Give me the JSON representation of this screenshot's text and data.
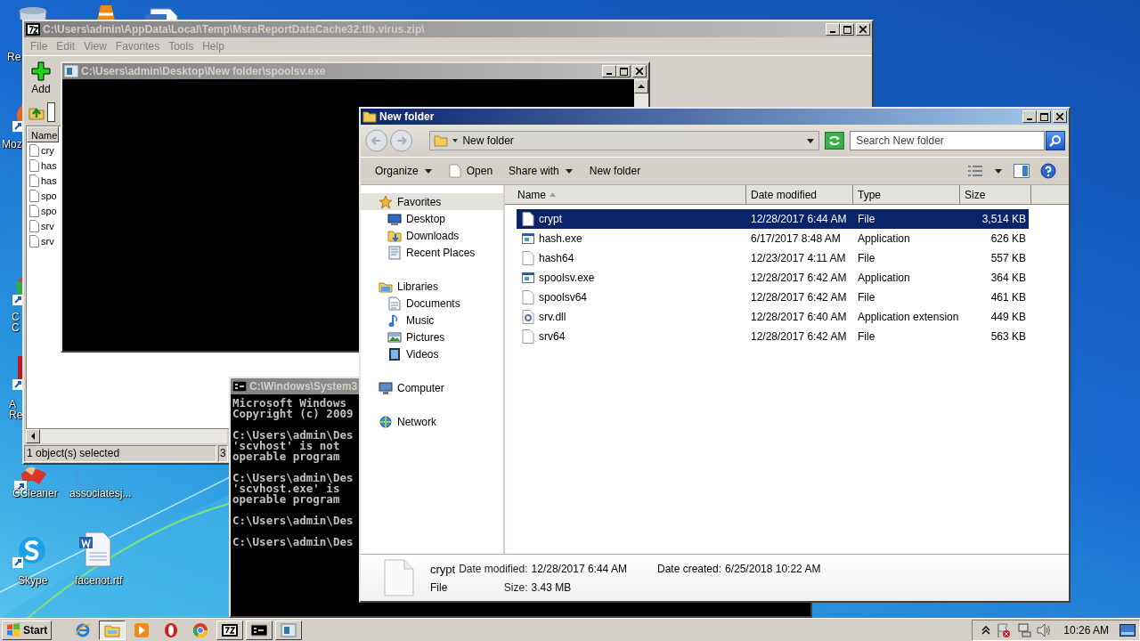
{
  "desktop": {
    "icons": [
      {
        "kind": "recycle",
        "lines": [
          "Re"
        ]
      },
      {
        "kind": "firefox",
        "lines": [
          "Moz"
        ]
      },
      {
        "kind": "chrome",
        "lines": [
          "C",
          "C"
        ]
      },
      {
        "kind": "acrobat",
        "lines": [
          "A",
          "Re"
        ]
      },
      {
        "kind": "ccleaner",
        "lines": [
          "CCleaner"
        ]
      },
      {
        "kind": "blank",
        "lines": [
          "associatesj..."
        ]
      },
      {
        "kind": "skype",
        "lines": [
          "Skype"
        ]
      },
      {
        "kind": "word",
        "lines": [
          "facenot.rtf"
        ]
      },
      {
        "kind": "vlc"
      },
      {
        "kind": "doc"
      }
    ]
  },
  "archive_window": {
    "title": "C:\\Users\\admin\\AppData\\Local\\Temp\\MsraReportDataCache32.tlb.virus.zip\\",
    "menu": [
      "File",
      "Edit",
      "View",
      "Favorites",
      "Tools",
      "Help"
    ],
    "toolbar": [
      "Add"
    ],
    "column": "Name",
    "files": [
      "cry",
      "has",
      "has",
      "spo",
      "spo",
      "srv",
      "srv"
    ],
    "status": [
      "1 object(s) selected",
      "3"
    ]
  },
  "console_window": {
    "title": "C:\\Users\\admin\\Desktop\\New folder\\spoolsv.exe"
  },
  "cmd_window": {
    "title": "C:\\Windows\\System3",
    "paragraphs": [
      [
        "Microsoft Windows",
        "Copyright (c) 2009"
      ],
      [
        "C:\\Users\\admin\\Des",
        "'scvhost' is not",
        "operable program"
      ],
      [
        "C:\\Users\\admin\\Des",
        "'scvhost.exe' is",
        "operable program"
      ],
      [
        "C:\\Users\\admin\\Des"
      ],
      [
        "C:\\Users\\admin\\Des"
      ]
    ]
  },
  "explorer": {
    "title": "New folder",
    "address": "New folder",
    "search": {
      "placeholder": "Search New folder"
    },
    "commands": [
      {
        "label": "Organize",
        "kind": "menu"
      },
      {
        "label": "Open",
        "kind": "file"
      },
      {
        "label": "Share with",
        "kind": "menu"
      },
      {
        "label": "New folder",
        "kind": "plain"
      }
    ],
    "nav": [
      {
        "label": "Favorites",
        "kind": "star",
        "selected": true,
        "children": [
          {
            "label": "Desktop",
            "kind": "desktop",
            "selected": false
          },
          {
            "label": "Downloads",
            "kind": "downloads",
            "selected": false
          },
          {
            "label": "Recent Places",
            "kind": "recent",
            "selected": false
          }
        ]
      },
      {
        "label": "Libraries",
        "kind": "libraries",
        "selected": false,
        "children": [
          {
            "label": "Documents",
            "kind": "documents",
            "selected": false
          },
          {
            "label": "Music",
            "kind": "music",
            "selected": false
          },
          {
            "label": "Pictures",
            "kind": "pictures",
            "selected": false
          },
          {
            "label": "Videos",
            "kind": "videos",
            "selected": false
          }
        ]
      },
      {
        "label": "Computer",
        "kind": "computer",
        "selected": false
      },
      {
        "label": "Network",
        "kind": "network",
        "selected": false
      }
    ],
    "columns": [
      {
        "label": "Name",
        "sorted": true
      },
      {
        "label": "Date modified",
        "sorted": false
      },
      {
        "label": "Type",
        "sorted": false
      },
      {
        "label": "Size",
        "sorted": false
      }
    ],
    "files": [
      {
        "name": "crypt",
        "kind": "file",
        "date": "12/28/2017 6:44 AM",
        "type": "File",
        "size": "3,514 KB",
        "selected": true
      },
      {
        "name": "hash.exe",
        "kind": "app",
        "date": "6/17/2017 8:48 AM",
        "type": "Application",
        "size": "626 KB",
        "selected": false
      },
      {
        "name": "hash64",
        "kind": "file",
        "date": "12/23/2017 4:11 AM",
        "type": "File",
        "size": "557 KB",
        "selected": false
      },
      {
        "name": "spoolsv.exe",
        "kind": "app",
        "date": "12/28/2017 6:42 AM",
        "type": "Application",
        "size": "364 KB",
        "selected": false
      },
      {
        "name": "spoolsv64",
        "kind": "file",
        "date": "12/28/2017 6:42 AM",
        "type": "File",
        "size": "461 KB",
        "selected": false
      },
      {
        "name": "srv.dll",
        "kind": "dll",
        "date": "12/28/2017 6:40 AM",
        "type": "Application extension",
        "size": "449 KB",
        "selected": false
      },
      {
        "name": "srv64",
        "kind": "file",
        "date": "12/28/2017 6:42 AM",
        "type": "File",
        "size": "563 KB",
        "selected": false
      }
    ],
    "details": {
      "name": "crypt",
      "type": "File",
      "fields": [
        {
          "label": "Date modified:",
          "value": "12/28/2017 6:44 AM"
        },
        {
          "label": "Size:",
          "value": "3.43 MB"
        },
        {
          "label": "Date created:",
          "value": "6/25/2018 10:22 AM"
        }
      ]
    }
  },
  "taskbar": {
    "start": "Start",
    "apps": [
      {
        "kind": "ie",
        "selected": false
      },
      {
        "kind": "explorer",
        "selected": true
      },
      {
        "kind": "media",
        "selected": false
      },
      {
        "kind": "opera",
        "selected": false
      },
      {
        "kind": "chrome",
        "selected": false
      },
      {
        "kind": "sevenzip",
        "selected": false
      },
      {
        "kind": "cmd",
        "selected": false
      },
      {
        "kind": "console",
        "selected": false
      }
    ],
    "clock": "10:26 AM"
  }
}
